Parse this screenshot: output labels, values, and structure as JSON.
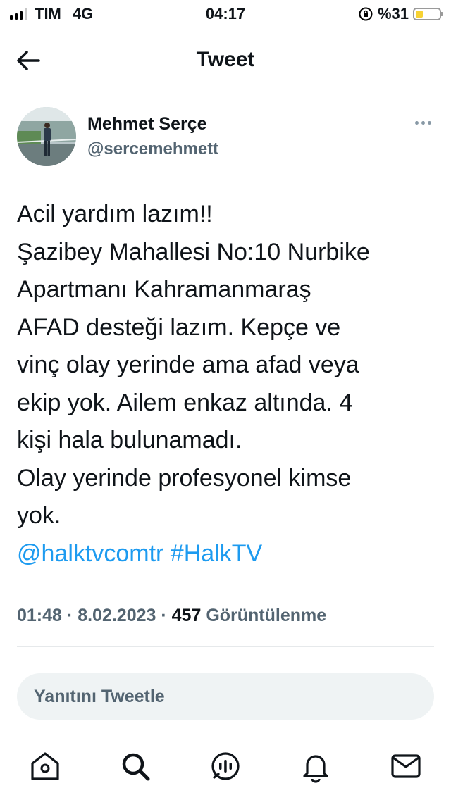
{
  "status_bar": {
    "carrier": "TIM",
    "network": "4G",
    "time": "04:17",
    "battery_text": "%31",
    "battery_level": 0.31,
    "battery_color": "#f7d233"
  },
  "header": {
    "title": "Tweet",
    "back_icon": "arrow-left-icon"
  },
  "tweet": {
    "author_name": "Mehmet Serçe",
    "author_handle": "@sercemehmett",
    "lines": [
      "Acil yardım lazım!!",
      "Şazibey Mahallesi No:10 Nurbike",
      "Apartmanı Kahramanmaraş",
      "AFAD desteği lazım. Kepçe ve",
      "vinç olay yerinde ama afad veya",
      "ekip yok. Ailem enkaz altında. 4",
      "kişi hala bulunamadı.",
      "Olay yerinde profesyonel kimse",
      "yok."
    ],
    "mention": "@halktvcomtr",
    "hashtag": "#HalkTV",
    "time": "01:48",
    "date": "8.02.2023",
    "view_count": "457",
    "view_label": "Görüntülenme"
  },
  "reply": {
    "placeholder": "Yanıtını Tweetle"
  },
  "tab_bar": {
    "icons": [
      "home-icon",
      "search-icon",
      "spaces-icon",
      "notifications-icon",
      "messages-icon"
    ]
  },
  "colors": {
    "link": "#1d9bf0",
    "secondary_text": "#536471",
    "primary_text": "#0f1419"
  }
}
